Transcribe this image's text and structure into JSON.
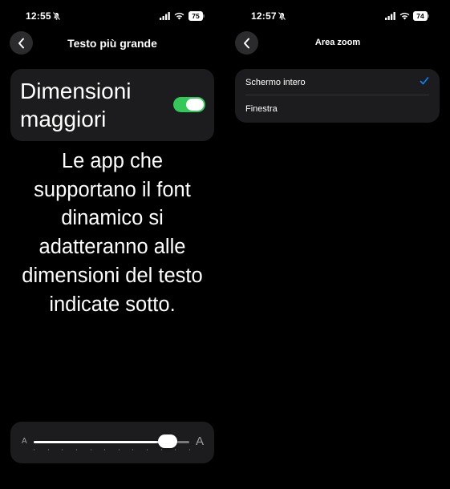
{
  "left_screen": {
    "status": {
      "time": "12:55",
      "battery": "75"
    },
    "nav": {
      "title": "Testo più grande"
    },
    "toggle": {
      "label": "Dimensioni maggiori",
      "on": true
    },
    "description": "Le app che supportano il font dinamico si adatteranno alle dimensioni del testo indicate sotto.",
    "slider": {
      "min_label": "A",
      "max_label": "A",
      "value_fraction": 0.86,
      "steps": 12
    }
  },
  "right_screen": {
    "status": {
      "time": "12:57",
      "battery": "74"
    },
    "nav": {
      "title": "Area zoom"
    },
    "options": [
      {
        "label": "Schermo intero",
        "selected": true
      },
      {
        "label": "Finestra",
        "selected": false
      }
    ]
  },
  "colors": {
    "accent_green": "#34c759",
    "accent_blue": "#0a84ff",
    "card_bg": "#1c1c1e"
  }
}
